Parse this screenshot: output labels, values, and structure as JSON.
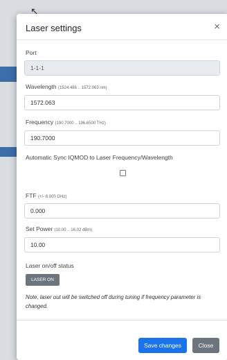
{
  "dialog": {
    "title": "Laser settings",
    "close_glyph": "×"
  },
  "fields": {
    "port": {
      "label": "Port",
      "value": "1-1-1"
    },
    "wavelength": {
      "label": "Wavelength",
      "range": "(1524.486 .. 1572.063 nm)",
      "value": "1572.063"
    },
    "frequency": {
      "label": "Frequency",
      "range": "(190.7000 .. 196.6500 THz)",
      "value": "190.7000"
    },
    "auto_sync": {
      "label": "Automatic Sync IQMOD to Laser Frequency/Wavelength",
      "checked": false
    },
    "ftf": {
      "label": "FTF",
      "range": "(+/- 6.000 GHz)",
      "value": "0.000"
    },
    "set_power": {
      "label": "Set Power",
      "range": "(10.00 .. 16.02 dBm)",
      "value": "10.00"
    },
    "laser_status": {
      "label": "Laser on/off status",
      "button_label": "LASER ON"
    }
  },
  "note": "Note, laser out will be switched off during tuning if frequency parameter is changed.",
  "footer": {
    "save_label": "Save changes",
    "close_label": "Close"
  },
  "colors": {
    "primary": "#1a73e8",
    "secondary": "#6c757d",
    "disabled_bg": "#e9ecef"
  }
}
